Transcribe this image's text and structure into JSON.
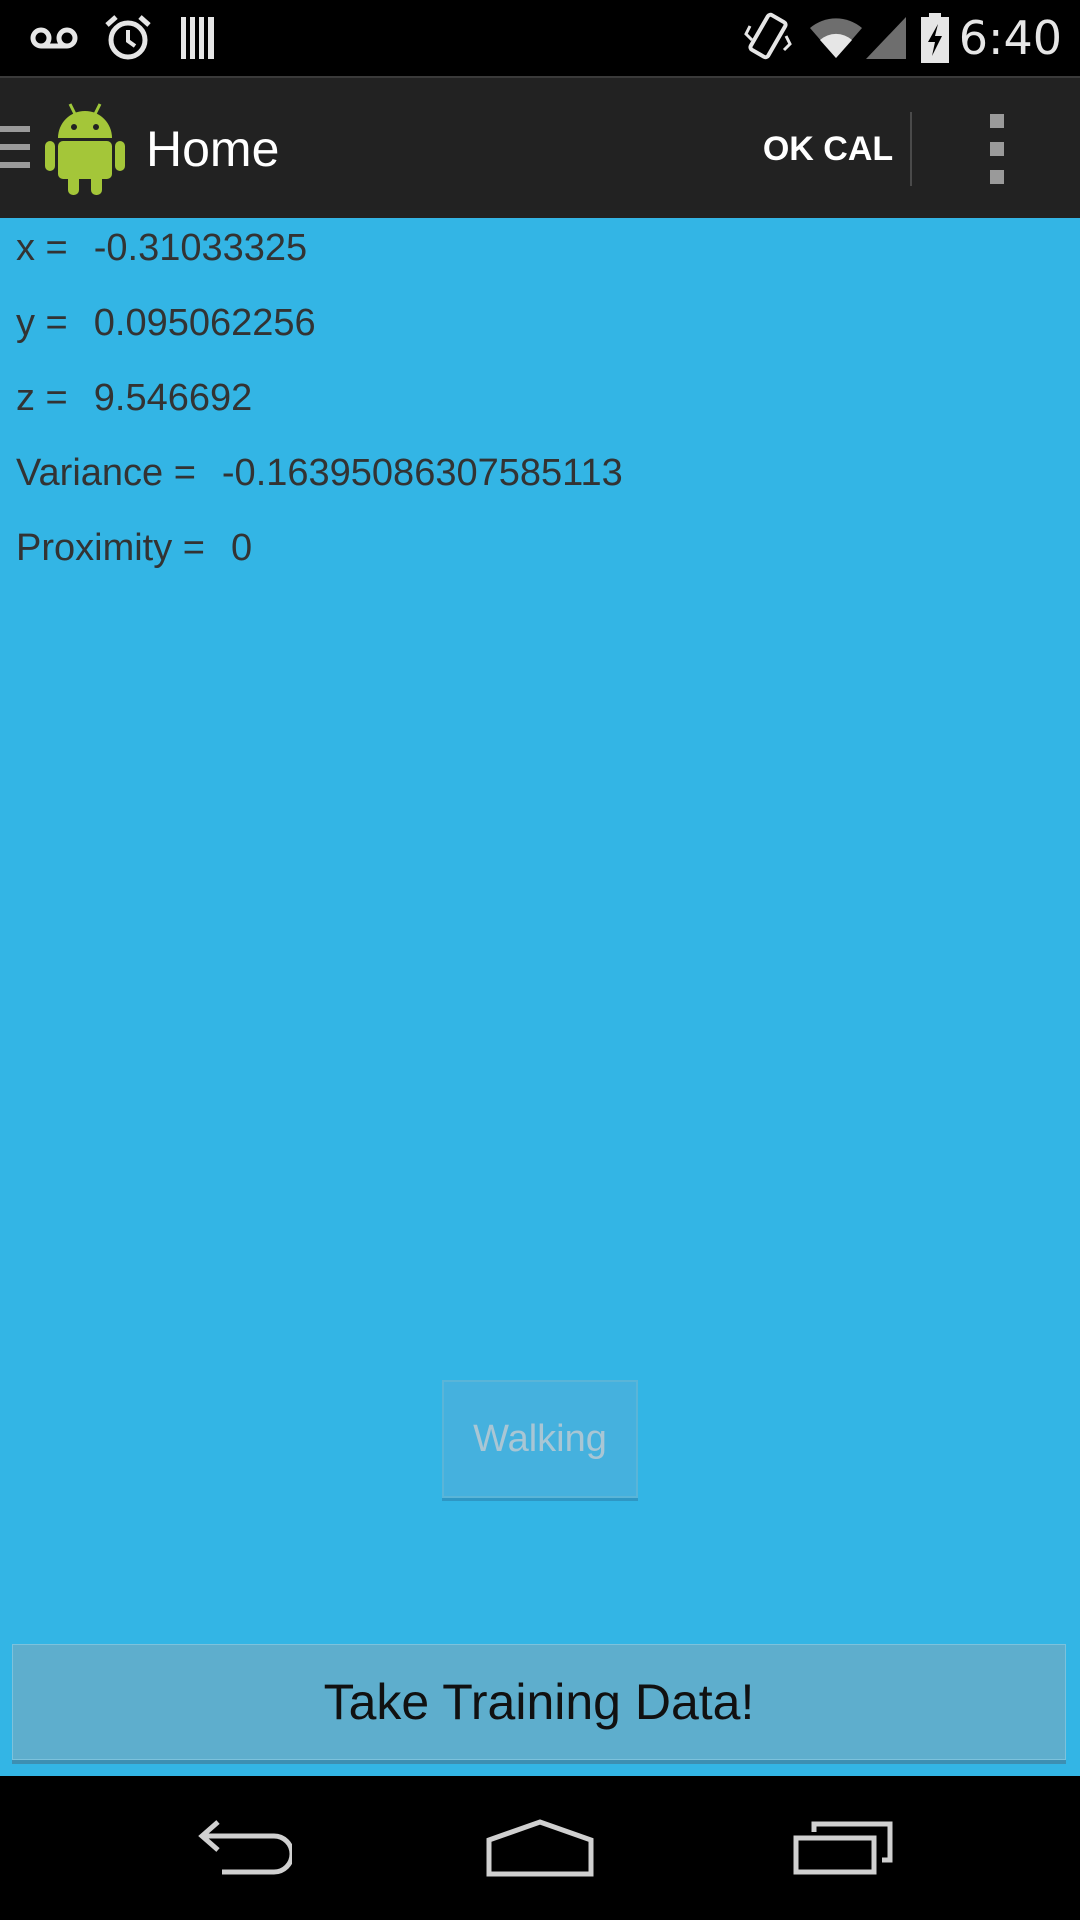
{
  "status_bar": {
    "time": "6:40",
    "icons_left": [
      "voicemail-icon",
      "alarm-icon",
      "barcode-icon"
    ],
    "icons_right": [
      "vibrate-icon",
      "wifi-icon",
      "signal-icon",
      "battery-charging-icon"
    ]
  },
  "action_bar": {
    "title": "Home",
    "ok_cal_label": "OK CAL",
    "logo_icon": "android-logo-icon",
    "overflow_icon": "overflow-menu-icon"
  },
  "readings": {
    "x": {
      "label": "x =",
      "value": "-0.31033325"
    },
    "y": {
      "label": "y =",
      "value": "0.095062256"
    },
    "z": {
      "label": "z =",
      "value": "9.546692"
    },
    "variance": {
      "label": "Variance =",
      "value": "-0.16395086307585113"
    },
    "proximity": {
      "label": "Proximity =",
      "value": "0"
    }
  },
  "buttons": {
    "walking_label": "Walking",
    "training_label": "Take Training Data!"
  },
  "nav_bar": {
    "icons": [
      "back-icon",
      "home-icon",
      "recents-icon"
    ]
  },
  "colors": {
    "background": "#33b5e5",
    "action_bar": "#222222",
    "status_bar": "#000000"
  }
}
